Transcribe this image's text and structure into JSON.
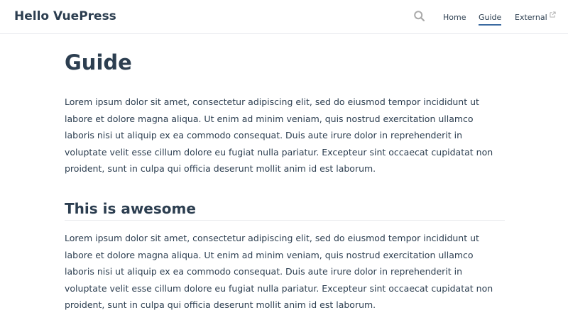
{
  "navbar": {
    "site_title": "Hello VuePress",
    "search_icon": "search-icon",
    "links": [
      {
        "label": "Home",
        "active": false
      },
      {
        "label": "Guide",
        "active": true
      },
      {
        "label": "External",
        "external": true,
        "icon": "external-link-icon"
      }
    ]
  },
  "page": {
    "title": "Guide",
    "intro": "Lorem ipsum dolor sit amet, consectetur adipiscing elit, sed do eiusmod tempor incididunt ut labore et dolore magna aliqua. Ut enim ad minim veniam, quis nostrud exercitation ullamco laboris nisi ut aliquip ex ea commodo consequat. Duis aute irure dolor in reprehenderit in voluptate velit esse cillum dolore eu fugiat nulla pariatur. Excepteur sint occaecat cupidatat non proident, sunt in culpa qui officia deserunt mollit anim id est laborum.",
    "section": {
      "heading": "This is awesome",
      "body": "Lorem ipsum dolor sit amet, consectetur adipiscing elit, sed do eiusmod tempor incididunt ut labore et dolore magna aliqua. Ut enim ad minim veniam, quis nostrud exercitation ullamco laboris nisi ut aliquip ex ea commodo consequat. Duis aute irure dolor in reprehenderit in voluptate velit esse cillum dolore eu fugiat nulla pariatur. Excepteur sint occaecat cupidatat non proident, sunt in culpa qui officia deserunt mollit anim id est laborum."
    }
  },
  "colors": {
    "text": "#2c3e50",
    "active_underline": "#3b6aa0",
    "border": "#eaecef",
    "icon": "#aaaaaa"
  }
}
